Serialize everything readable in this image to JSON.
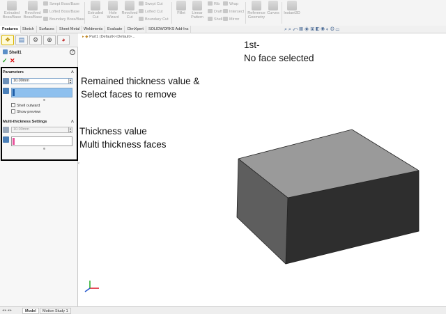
{
  "toolbar": {
    "tools": [
      {
        "label": "Extruded\nBoss/Base",
        "icon": "extruded-boss-icon"
      },
      {
        "label": "Revolved\nBoss/Base",
        "icon": "revolved-boss-icon"
      },
      {
        "label": "Extruded\nCut",
        "icon": "extruded-cut-icon"
      },
      {
        "label": "Hole\nWizard",
        "icon": "hole-wizard-icon"
      },
      {
        "label": "Revolved\nCut",
        "icon": "revolved-cut-icon"
      },
      {
        "label": "Fillet",
        "icon": "fillet-icon"
      },
      {
        "label": "Linear\nPattern",
        "icon": "linear-pattern-icon"
      },
      {
        "label": "Reference\nGeometry",
        "icon": "reference-geometry-icon"
      },
      {
        "label": "Curves",
        "icon": "curves-icon"
      },
      {
        "label": "Instant3D",
        "icon": "instant3d-icon"
      }
    ],
    "boss_stack": [
      "Swept Boss/Base",
      "Lofted Boss/Base",
      "Boundary Boss/Base"
    ],
    "cut_stack": [
      "Swept Cut",
      "Lofted Cut",
      "Boundary Cut"
    ],
    "feature_stack_a": [
      "Rib",
      "Draft",
      "Shell"
    ],
    "feature_stack_b": [
      "Wrap",
      "Intersect",
      "Mirror"
    ]
  },
  "tabs": [
    "Features",
    "Sketch",
    "Surfaces",
    "Sheet Metal",
    "Weldments",
    "Evaluate",
    "DimXpert",
    "SOLIDWORKS Add-Ins"
  ],
  "active_tab": "Features",
  "breadcrumb": "Part1  (Default<<Default>...",
  "property_manager": {
    "title": "Shell1",
    "help_label": "?",
    "ok_label": "✓",
    "cancel_label": "✕",
    "parameters": {
      "header": "Parameters",
      "thickness_value": "10.00mm",
      "shell_outward_label": "Shell outward",
      "show_preview_label": "Show preview"
    },
    "multi_thickness": {
      "header": "Multi-thickness Settings",
      "thickness_value": "10.00mm"
    }
  },
  "annotations": {
    "params_line1": "Remained thickness value &",
    "params_line2": "Select faces to remove",
    "multi_line1": "Thickness value",
    "multi_line2": "Multi thickness faces",
    "note_line1": "1st-",
    "note_line2": "No face selected"
  },
  "bottom_tabs": [
    "Model",
    "Motion Study 1"
  ],
  "active_bottom_tab": "Model",
  "colors": {
    "face_selection": "#4a90d9",
    "multi_face_selection": "#e8539c",
    "ok_green": "#22a025",
    "cancel_red": "#dd1111",
    "block_top": "#9a9a9a",
    "block_front": "#5e5e5e",
    "block_side": "#2e2e2e"
  }
}
